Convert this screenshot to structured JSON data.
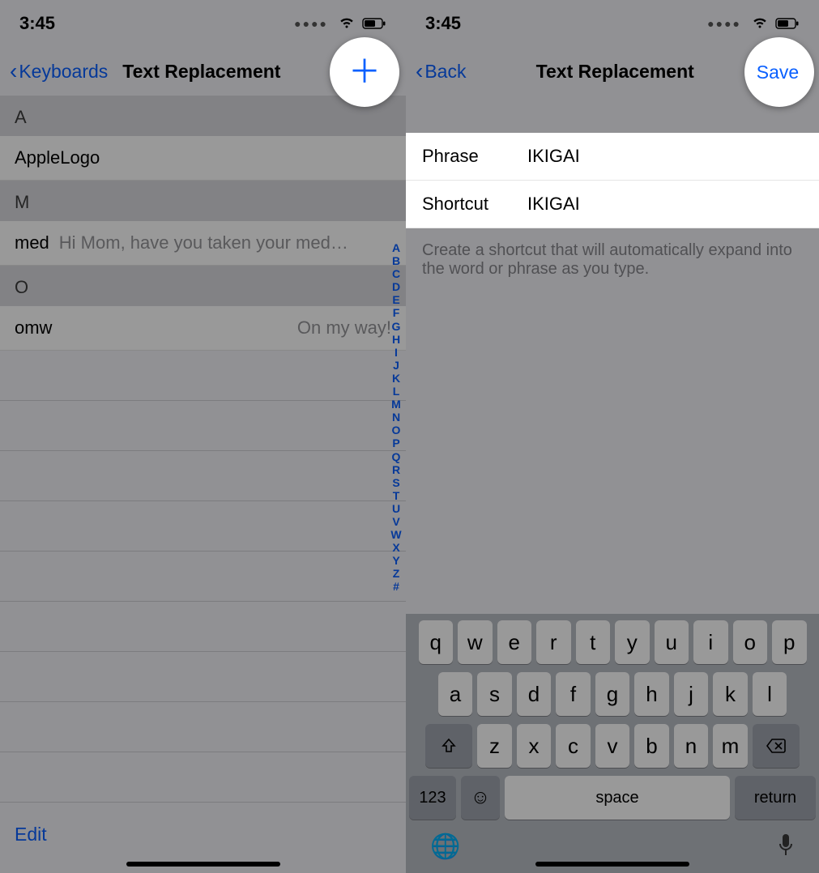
{
  "status": {
    "time": "3:45"
  },
  "left": {
    "nav": {
      "back": "Keyboards",
      "title": "Text Replacement"
    },
    "index_letters": [
      "A",
      "B",
      "C",
      "D",
      "E",
      "F",
      "G",
      "H",
      "I",
      "J",
      "K",
      "L",
      "M",
      "N",
      "O",
      "P",
      "Q",
      "R",
      "S",
      "T",
      "U",
      "V",
      "W",
      "X",
      "Y",
      "Z",
      "#"
    ],
    "sections": [
      {
        "header": "A",
        "rows": [
          {
            "shortcut": "AppleLogo",
            "phrase": "",
            "icon": "apple"
          }
        ]
      },
      {
        "header": "M",
        "rows": [
          {
            "shortcut": "med",
            "phrase": "Hi Mom, have you taken your med…"
          }
        ]
      },
      {
        "header": "O",
        "rows": [
          {
            "shortcut": "omw",
            "phrase": "On my way!",
            "align": "right"
          }
        ]
      }
    ],
    "edit": "Edit"
  },
  "right": {
    "nav": {
      "back": "Back",
      "title": "Text Replacement",
      "save": "Save"
    },
    "form": {
      "phrase_label": "Phrase",
      "phrase_value": "IKIGAI",
      "shortcut_label": "Shortcut",
      "shortcut_value": "IKIGAI"
    },
    "hint": "Create a shortcut that will automatically expand into the word or phrase as you type.",
    "keyboard": {
      "row1": [
        "q",
        "w",
        "e",
        "r",
        "t",
        "y",
        "u",
        "i",
        "o",
        "p"
      ],
      "row2": [
        "a",
        "s",
        "d",
        "f",
        "g",
        "h",
        "j",
        "k",
        "l"
      ],
      "row3": [
        "z",
        "x",
        "c",
        "v",
        "b",
        "n",
        "m"
      ],
      "num": "123",
      "space": "space",
      "return": "return"
    }
  }
}
